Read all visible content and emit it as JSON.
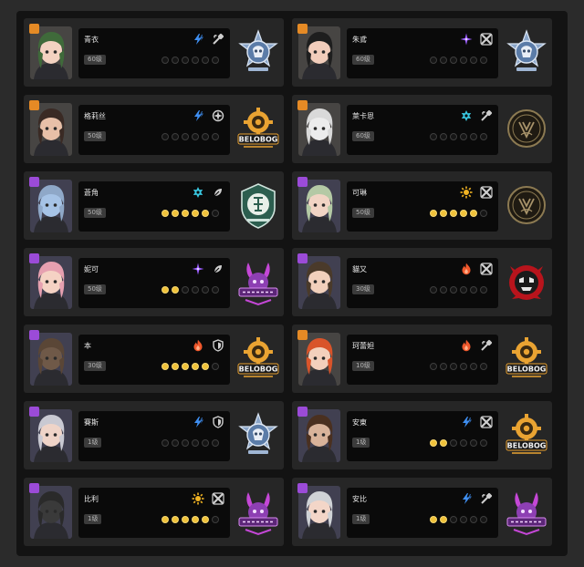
{
  "colors": {
    "rank_s": "#e58a25",
    "rank_a": "#9b4bd8",
    "pip_on": "#f0c23b",
    "attr": {
      "electric": "#3f8ff2",
      "ether": "#9a5bff",
      "ice": "#39c7e0",
      "physical": "#f0b323",
      "fire": "#f0582c"
    }
  },
  "agents": [
    {
      "name": "青衣",
      "level": "60级",
      "rank": "S",
      "attribute": "electric-icon",
      "type": "stun-icon",
      "faction": "hsos6-emblem",
      "pips_filled": 0,
      "portrait": {
        "hair": "#3f6a3a",
        "skin": "#f3d2c1"
      }
    },
    {
      "name": "朱鳶",
      "level": "60级",
      "rank": "S",
      "attribute": "ether-icon",
      "type": "attack-icon",
      "faction": "hsos6-emblem",
      "pips_filled": 0,
      "portrait": {
        "hair": "#1e1e1e",
        "skin": "#f2cdbb"
      }
    },
    {
      "name": "格莉丝",
      "level": "50级",
      "rank": "S",
      "attribute": "electric-icon",
      "type": "anomaly-icon",
      "faction": "belobog-emblem",
      "pips_filled": 0,
      "portrait": {
        "hair": "#3a2a24",
        "skin": "#e8c0a8"
      }
    },
    {
      "name": "萊卡恩",
      "level": "60级",
      "rank": "S",
      "attribute": "ice-icon",
      "type": "stun-icon",
      "faction": "victoria-emblem",
      "pips_filled": 0,
      "portrait": {
        "hair": "#d9d9d9",
        "skin": "#ececec"
      }
    },
    {
      "name": "蒼角",
      "level": "50级",
      "rank": "A",
      "attribute": "ice-icon",
      "type": "support-icon",
      "faction": "section6-emblem",
      "pips_filled": 5,
      "portrait": {
        "hair": "#8fa8c8",
        "skin": "#a6c3e6"
      }
    },
    {
      "name": "可琳",
      "level": "50级",
      "rank": "A",
      "attribute": "physical-icon",
      "type": "attack-icon",
      "faction": "victoria-emblem",
      "pips_filled": 5,
      "portrait": {
        "hair": "#b4c9a5",
        "skin": "#f1d4c4"
      }
    },
    {
      "name": "妮可",
      "level": "50级",
      "rank": "A",
      "attribute": "ether-icon",
      "type": "support-icon",
      "faction": "cunning-hares-emblem",
      "pips_filled": 2,
      "portrait": {
        "hair": "#e6a0b0",
        "skin": "#f5d2c4"
      }
    },
    {
      "name": "貓又",
      "level": "30级",
      "rank": "A",
      "attribute": "fire-icon",
      "type": "attack-icon",
      "faction": "sons-of-calydon-emblem",
      "pips_filled": 0,
      "portrait": {
        "hair": "#4a3a2a",
        "skin": "#f1d0bc"
      }
    },
    {
      "name": "本",
      "level": "30级",
      "rank": "A",
      "attribute": "fire-icon",
      "type": "defense-icon",
      "faction": "belobog-emblem",
      "pips_filled": 5,
      "portrait": {
        "hair": "#5a4636",
        "skin": "#6f5948"
      }
    },
    {
      "name": "珂蕾妲",
      "level": "10级",
      "rank": "S",
      "attribute": "fire-icon",
      "type": "stun-icon",
      "faction": "belobog-emblem",
      "pips_filled": 0,
      "portrait": {
        "hair": "#d9542a",
        "skin": "#f3d0bc"
      }
    },
    {
      "name": "賽斯",
      "level": "1级",
      "rank": "A",
      "attribute": "electric-icon",
      "type": "defense-icon",
      "faction": "hsos6-emblem",
      "pips_filled": 0,
      "portrait": {
        "hair": "#c9c9d2",
        "skin": "#efd4c8"
      }
    },
    {
      "name": "安東",
      "level": "1级",
      "rank": "A",
      "attribute": "electric-icon",
      "type": "attack-icon",
      "faction": "belobog-emblem",
      "pips_filled": 2,
      "portrait": {
        "hair": "#4a3020",
        "skin": "#d9b39a"
      }
    },
    {
      "name": "比利",
      "level": "1级",
      "rank": "A",
      "attribute": "physical-icon",
      "type": "attack-icon",
      "faction": "cunning-hares-emblem",
      "pips_filled": 5,
      "portrait": {
        "hair": "#2a2a2a",
        "skin": "#3a3a3a"
      }
    },
    {
      "name": "安比",
      "level": "1级",
      "rank": "A",
      "attribute": "electric-icon",
      "type": "stun-icon",
      "faction": "cunning-hares-emblem",
      "pips_filled": 2,
      "portrait": {
        "hair": "#cfd2d6",
        "skin": "#f3d6c8"
      }
    }
  ]
}
